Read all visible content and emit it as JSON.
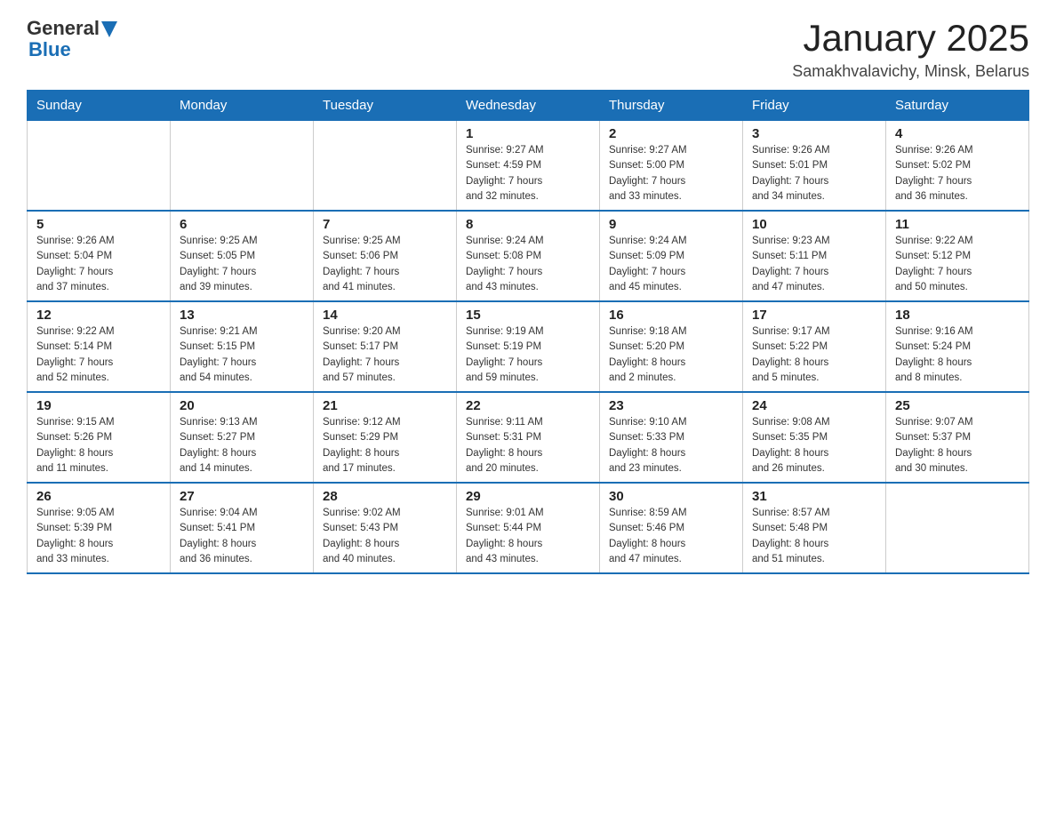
{
  "header": {
    "logo_general": "General",
    "logo_blue": "Blue",
    "title": "January 2025",
    "subtitle": "Samakhvalavichy, Minsk, Belarus"
  },
  "weekdays": [
    "Sunday",
    "Monday",
    "Tuesday",
    "Wednesday",
    "Thursday",
    "Friday",
    "Saturday"
  ],
  "weeks": [
    [
      {
        "day": "",
        "info": ""
      },
      {
        "day": "",
        "info": ""
      },
      {
        "day": "",
        "info": ""
      },
      {
        "day": "1",
        "info": "Sunrise: 9:27 AM\nSunset: 4:59 PM\nDaylight: 7 hours\nand 32 minutes."
      },
      {
        "day": "2",
        "info": "Sunrise: 9:27 AM\nSunset: 5:00 PM\nDaylight: 7 hours\nand 33 minutes."
      },
      {
        "day": "3",
        "info": "Sunrise: 9:26 AM\nSunset: 5:01 PM\nDaylight: 7 hours\nand 34 minutes."
      },
      {
        "day": "4",
        "info": "Sunrise: 9:26 AM\nSunset: 5:02 PM\nDaylight: 7 hours\nand 36 minutes."
      }
    ],
    [
      {
        "day": "5",
        "info": "Sunrise: 9:26 AM\nSunset: 5:04 PM\nDaylight: 7 hours\nand 37 minutes."
      },
      {
        "day": "6",
        "info": "Sunrise: 9:25 AM\nSunset: 5:05 PM\nDaylight: 7 hours\nand 39 minutes."
      },
      {
        "day": "7",
        "info": "Sunrise: 9:25 AM\nSunset: 5:06 PM\nDaylight: 7 hours\nand 41 minutes."
      },
      {
        "day": "8",
        "info": "Sunrise: 9:24 AM\nSunset: 5:08 PM\nDaylight: 7 hours\nand 43 minutes."
      },
      {
        "day": "9",
        "info": "Sunrise: 9:24 AM\nSunset: 5:09 PM\nDaylight: 7 hours\nand 45 minutes."
      },
      {
        "day": "10",
        "info": "Sunrise: 9:23 AM\nSunset: 5:11 PM\nDaylight: 7 hours\nand 47 minutes."
      },
      {
        "day": "11",
        "info": "Sunrise: 9:22 AM\nSunset: 5:12 PM\nDaylight: 7 hours\nand 50 minutes."
      }
    ],
    [
      {
        "day": "12",
        "info": "Sunrise: 9:22 AM\nSunset: 5:14 PM\nDaylight: 7 hours\nand 52 minutes."
      },
      {
        "day": "13",
        "info": "Sunrise: 9:21 AM\nSunset: 5:15 PM\nDaylight: 7 hours\nand 54 minutes."
      },
      {
        "day": "14",
        "info": "Sunrise: 9:20 AM\nSunset: 5:17 PM\nDaylight: 7 hours\nand 57 minutes."
      },
      {
        "day": "15",
        "info": "Sunrise: 9:19 AM\nSunset: 5:19 PM\nDaylight: 7 hours\nand 59 minutes."
      },
      {
        "day": "16",
        "info": "Sunrise: 9:18 AM\nSunset: 5:20 PM\nDaylight: 8 hours\nand 2 minutes."
      },
      {
        "day": "17",
        "info": "Sunrise: 9:17 AM\nSunset: 5:22 PM\nDaylight: 8 hours\nand 5 minutes."
      },
      {
        "day": "18",
        "info": "Sunrise: 9:16 AM\nSunset: 5:24 PM\nDaylight: 8 hours\nand 8 minutes."
      }
    ],
    [
      {
        "day": "19",
        "info": "Sunrise: 9:15 AM\nSunset: 5:26 PM\nDaylight: 8 hours\nand 11 minutes."
      },
      {
        "day": "20",
        "info": "Sunrise: 9:13 AM\nSunset: 5:27 PM\nDaylight: 8 hours\nand 14 minutes."
      },
      {
        "day": "21",
        "info": "Sunrise: 9:12 AM\nSunset: 5:29 PM\nDaylight: 8 hours\nand 17 minutes."
      },
      {
        "day": "22",
        "info": "Sunrise: 9:11 AM\nSunset: 5:31 PM\nDaylight: 8 hours\nand 20 minutes."
      },
      {
        "day": "23",
        "info": "Sunrise: 9:10 AM\nSunset: 5:33 PM\nDaylight: 8 hours\nand 23 minutes."
      },
      {
        "day": "24",
        "info": "Sunrise: 9:08 AM\nSunset: 5:35 PM\nDaylight: 8 hours\nand 26 minutes."
      },
      {
        "day": "25",
        "info": "Sunrise: 9:07 AM\nSunset: 5:37 PM\nDaylight: 8 hours\nand 30 minutes."
      }
    ],
    [
      {
        "day": "26",
        "info": "Sunrise: 9:05 AM\nSunset: 5:39 PM\nDaylight: 8 hours\nand 33 minutes."
      },
      {
        "day": "27",
        "info": "Sunrise: 9:04 AM\nSunset: 5:41 PM\nDaylight: 8 hours\nand 36 minutes."
      },
      {
        "day": "28",
        "info": "Sunrise: 9:02 AM\nSunset: 5:43 PM\nDaylight: 8 hours\nand 40 minutes."
      },
      {
        "day": "29",
        "info": "Sunrise: 9:01 AM\nSunset: 5:44 PM\nDaylight: 8 hours\nand 43 minutes."
      },
      {
        "day": "30",
        "info": "Sunrise: 8:59 AM\nSunset: 5:46 PM\nDaylight: 8 hours\nand 47 minutes."
      },
      {
        "day": "31",
        "info": "Sunrise: 8:57 AM\nSunset: 5:48 PM\nDaylight: 8 hours\nand 51 minutes."
      },
      {
        "day": "",
        "info": ""
      }
    ]
  ]
}
